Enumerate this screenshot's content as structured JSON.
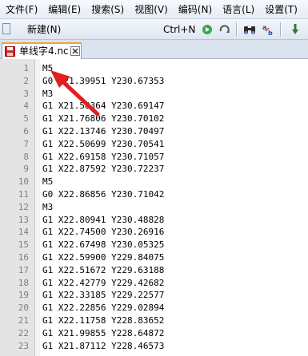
{
  "menu": [
    {
      "name": "menu-file",
      "label": "文件(F)"
    },
    {
      "name": "menu-edit",
      "label": "编辑(E)"
    },
    {
      "name": "menu-search",
      "label": "搜索(S)"
    },
    {
      "name": "menu-view",
      "label": "视图(V)"
    },
    {
      "name": "menu-encoding",
      "label": "编码(N)"
    },
    {
      "name": "menu-language",
      "label": "语言(L)"
    },
    {
      "name": "menu-settings",
      "label": "设置(T)"
    }
  ],
  "toolbar": {
    "new_label": "新建(N)",
    "new_shortcut": "Ctrl+N",
    "icons": [
      "new-file-icon",
      "run-icon",
      "redo-icon",
      "binoculars-icon",
      "find-replace-icon",
      "pin-icon"
    ]
  },
  "tab": {
    "label": "单线字4.nc",
    "icon": "save-icon",
    "close_icon": "close-icon"
  },
  "editor": {
    "lines": [
      {
        "num": "1",
        "code": "M5"
      },
      {
        "num": "2",
        "code": "G0 X21.39951 Y230.67353"
      },
      {
        "num": "3",
        "code": "M3"
      },
      {
        "num": "4",
        "code": "G1 X21.58364 Y230.69147"
      },
      {
        "num": "5",
        "code": "G1 X21.76806 Y230.70102"
      },
      {
        "num": "6",
        "code": "G1 X22.13746 Y230.70497"
      },
      {
        "num": "7",
        "code": "G1 X22.50699 Y230.70541"
      },
      {
        "num": "8",
        "code": "G1 X22.69158 Y230.71057"
      },
      {
        "num": "9",
        "code": "G1 X22.87592 Y230.72237"
      },
      {
        "num": "10",
        "code": "M5"
      },
      {
        "num": "11",
        "code": "G0 X22.86856 Y230.71042"
      },
      {
        "num": "12",
        "code": "M3"
      },
      {
        "num": "13",
        "code": "G1 X22.80941 Y230.48828"
      },
      {
        "num": "14",
        "code": "G1 X22.74500 Y230.26916"
      },
      {
        "num": "15",
        "code": "G1 X22.67498 Y230.05325"
      },
      {
        "num": "16",
        "code": "G1 X22.59900 Y229.84075"
      },
      {
        "num": "17",
        "code": "G1 X22.51672 Y229.63188"
      },
      {
        "num": "18",
        "code": "G1 X22.42779 Y229.42682"
      },
      {
        "num": "19",
        "code": "G1 X22.33185 Y229.22577"
      },
      {
        "num": "20",
        "code": "G1 X22.22856 Y229.02894"
      },
      {
        "num": "21",
        "code": "G1 X22.11758 Y228.83652"
      },
      {
        "num": "22",
        "code": "G1 X21.99855 Y228.64872"
      },
      {
        "num": "23",
        "code": "G1 X21.87112 Y228.46573"
      }
    ]
  },
  "annotation": {
    "arrow_color": "#e02020",
    "points_to_line": "1"
  }
}
